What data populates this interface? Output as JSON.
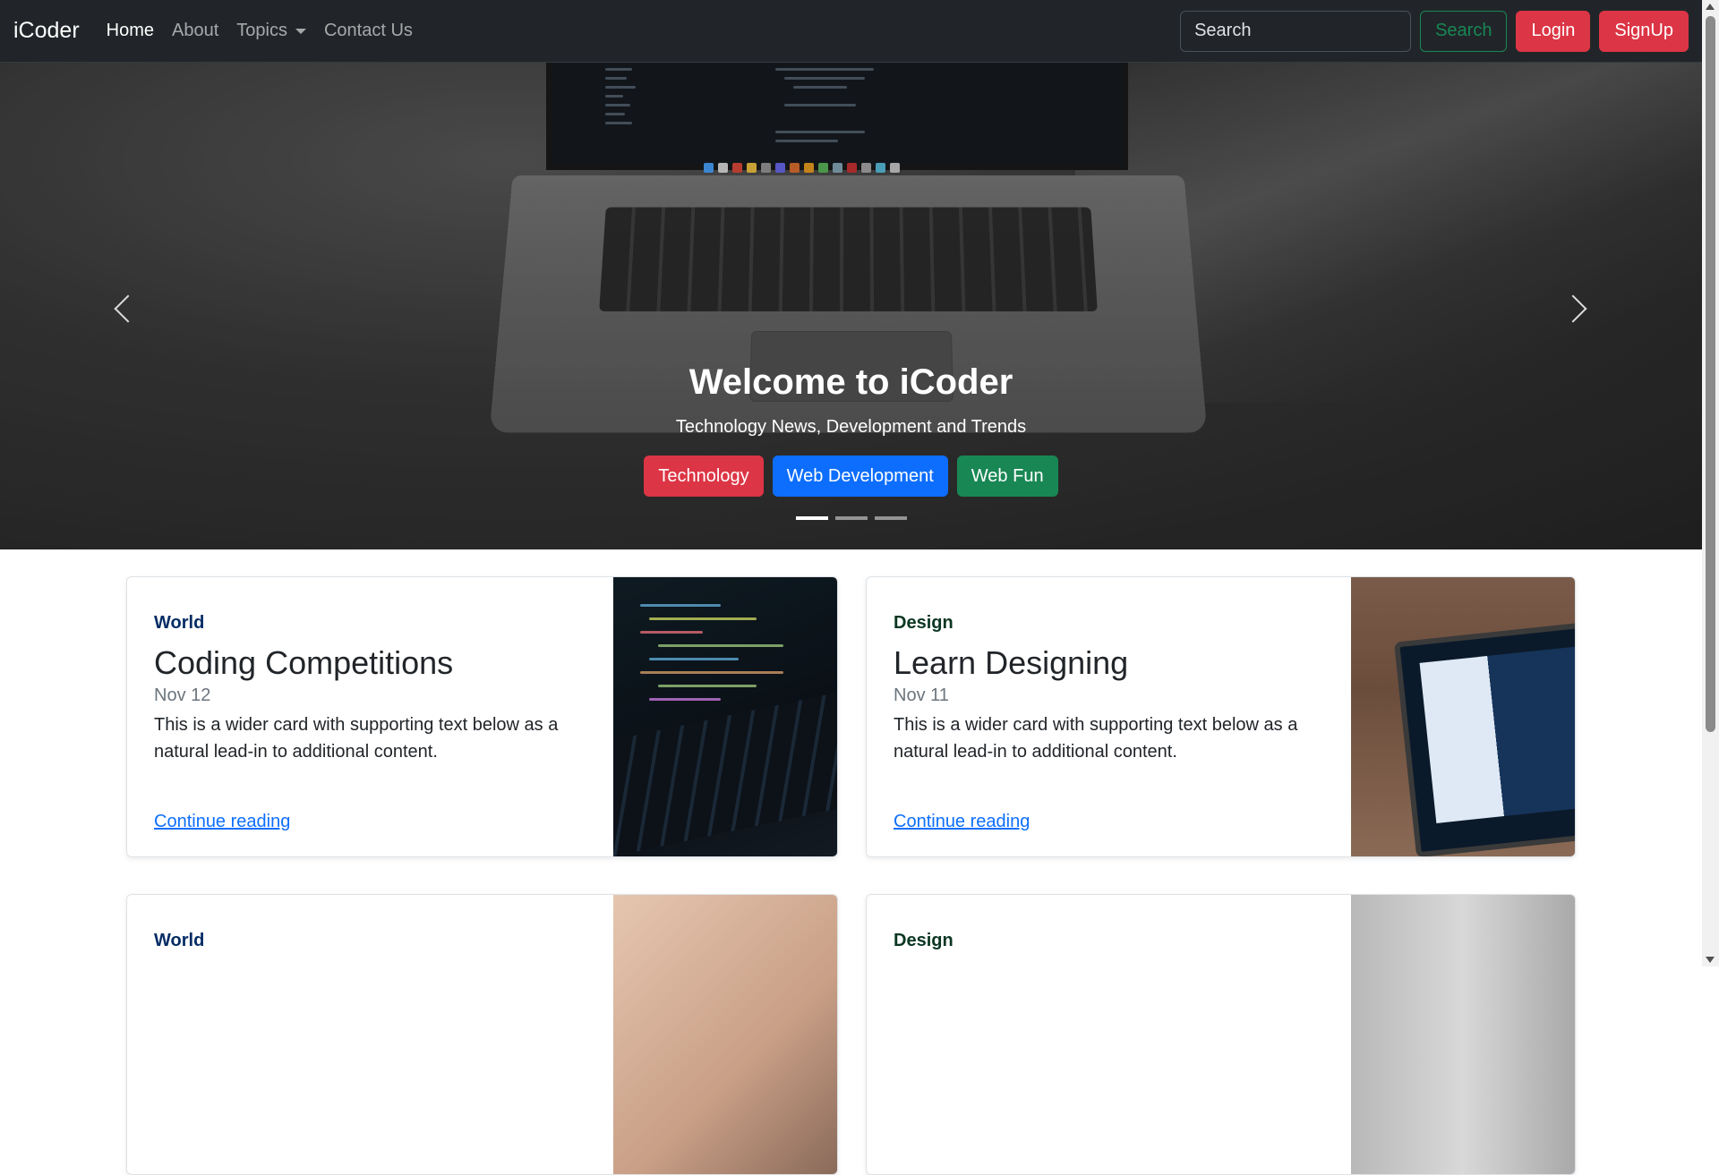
{
  "navbar": {
    "brand": "iCoder",
    "links": [
      {
        "label": "Home"
      },
      {
        "label": "About"
      },
      {
        "label": "Topics"
      },
      {
        "label": "Contact Us"
      }
    ],
    "search_placeholder": "Search",
    "search_button": "Search",
    "login_button": "Login",
    "signup_button": "SignUp"
  },
  "hero": {
    "title": "Welcome to iCoder",
    "subtitle": "Technology News, Development and Trends",
    "tags": [
      "Technology",
      "Web Development",
      "Web Fun"
    ],
    "slide_count": 3,
    "active_slide": 1
  },
  "cards": [
    {
      "category": "World",
      "title": "Coding Competitions",
      "date": "Nov 12",
      "text": "This is a wider card with supporting text below as a natural lead-in to additional content.",
      "link": "Continue reading"
    },
    {
      "category": "Design",
      "title": "Learn Designing",
      "date": "Nov 11",
      "text": "This is a wider card with supporting text below as a natural lead-in to additional content.",
      "link": "Continue reading"
    },
    {
      "category": "World",
      "title": "",
      "date": "",
      "text": "",
      "link": ""
    },
    {
      "category": "Design",
      "title": "",
      "date": "",
      "text": "",
      "link": ""
    }
  ],
  "colors": {
    "navbar_bg": "#212529",
    "danger": "#dc3545",
    "primary": "#0d6efd",
    "success": "#198754"
  }
}
